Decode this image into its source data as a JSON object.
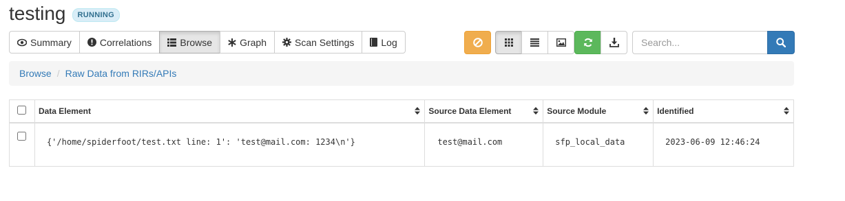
{
  "scan": {
    "name": "testing",
    "status": "RUNNING"
  },
  "tabs": [
    {
      "label": "Summary",
      "icon": "eye-icon"
    },
    {
      "label": "Correlations",
      "icon": "exclamation-circle-icon"
    },
    {
      "label": "Browse",
      "icon": "list-icon",
      "active": true
    },
    {
      "label": "Graph",
      "icon": "asterisk-icon"
    },
    {
      "label": "Scan Settings",
      "icon": "gear-icon"
    },
    {
      "label": "Log",
      "icon": "book-icon"
    }
  ],
  "toolbar": {
    "buttons": [
      "stop-icon",
      "grid-view-icon",
      "list-view-icon",
      "image-view-icon",
      "refresh-icon",
      "download-icon"
    ]
  },
  "search": {
    "placeholder": "Search...",
    "value": ""
  },
  "breadcrumb": {
    "root": "Browse",
    "current": "Raw Data from RIRs/APIs"
  },
  "table": {
    "columns": [
      "Data Element",
      "Source Data Element",
      "Source Module",
      "Identified"
    ],
    "rows": [
      {
        "data_element": "{'/home/spiderfoot/test.txt line: 1': 'test@mail.com: 1234\\n'}",
        "source_data_element": "test@mail.com",
        "source_module": "sfp_local_data",
        "identified": "2023-06-09 12:46:24"
      }
    ]
  },
  "colors": {
    "warning": "#f0ad4e",
    "success": "#5cb85c",
    "primary": "#337ab7",
    "badge_bg": "#d9edf7",
    "badge_text": "#31708f"
  }
}
